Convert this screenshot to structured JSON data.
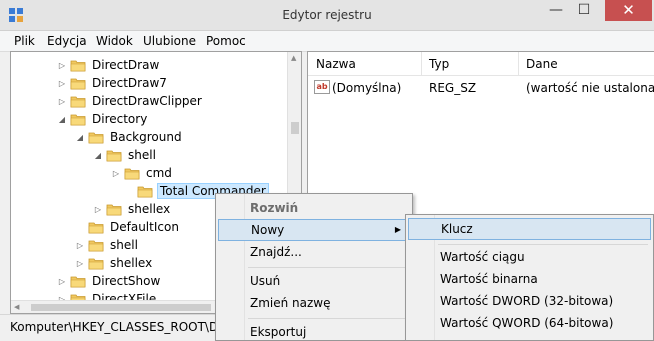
{
  "window": {
    "title": "Edytor rejestru",
    "minimize": "—",
    "maximize": "☐",
    "close": "✕"
  },
  "menubar": {
    "items": [
      "Plik",
      "Edycja",
      "Widok",
      "Ulubione",
      "Pomoc"
    ]
  },
  "tree": {
    "items": [
      {
        "label": "DirectDraw",
        "expander": "▷"
      },
      {
        "label": "DirectDraw7",
        "expander": "▷"
      },
      {
        "label": "DirectDrawClipper",
        "expander": "▷"
      },
      {
        "label": "Directory",
        "expander": "◢"
      },
      {
        "label": "Background",
        "expander": "◢"
      },
      {
        "label": "shell",
        "expander": "◢"
      },
      {
        "label": "cmd",
        "expander": "▷"
      },
      {
        "label": "Total Commander",
        "expander": ""
      },
      {
        "label": "shellex",
        "expander": "▷"
      },
      {
        "label": "DefaultIcon",
        "expander": ""
      },
      {
        "label": "shell",
        "expander": "▷"
      },
      {
        "label": "shellex",
        "expander": "▷"
      },
      {
        "label": "DirectShow",
        "expander": "▷"
      },
      {
        "label": "DirectXFile",
        "expander": "▷"
      }
    ]
  },
  "list": {
    "headers": {
      "name": "Nazwa",
      "type": "Typ",
      "data": "Dane"
    },
    "rows": [
      {
        "name": "(Domyślna)",
        "type": "REG_SZ",
        "data": "(wartość nie ustalona)",
        "icon": "ab"
      }
    ]
  },
  "status": {
    "path": "Komputer\\HKEY_CLASSES_ROOT\\Direc"
  },
  "context_menu": {
    "items": {
      "expand": "Rozwiń",
      "new": "Nowy",
      "find": "Znajdź...",
      "delete": "Usuń",
      "rename": "Zmień nazwę",
      "export": "Eksportuj"
    },
    "submenu_arrow": "▶"
  },
  "submenu": {
    "items": {
      "key": "Klucz",
      "string": "Wartość ciągu",
      "binary": "Wartość binarna",
      "dword": "Wartość DWORD (32-bitowa)",
      "qword": "Wartość QWORD (64-bitowa)"
    }
  },
  "colors": {
    "selection": "#cce8ff",
    "menu_highlight": "#d8e6f2",
    "close_button": "#c75050"
  }
}
